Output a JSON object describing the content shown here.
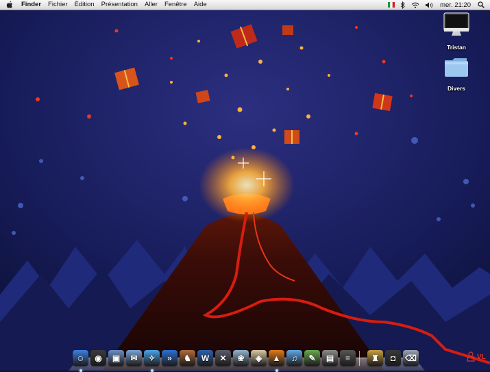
{
  "menubar": {
    "app_name": "Finder",
    "menus": [
      "Fichier",
      "Édition",
      "Présentation",
      "Aller",
      "Fenêtre",
      "Aide"
    ],
    "clock": "mer. 21:20"
  },
  "desktop": {
    "icons": [
      {
        "label": "Tristan",
        "icon": "imac-icon"
      },
      {
        "label": "Divers",
        "icon": "folder-icon"
      }
    ]
  },
  "dock": {
    "apps": [
      {
        "name": "finder",
        "color": "#3c7fe0",
        "glyph": "☺",
        "running": true
      },
      {
        "name": "dashboard",
        "color": "#3a3a3a",
        "glyph": "◉",
        "running": false
      },
      {
        "name": "preview",
        "color": "#6b8fc4",
        "glyph": "▣",
        "running": false
      },
      {
        "name": "mail-stamp",
        "color": "#7aa2d6",
        "glyph": "✉",
        "running": false
      },
      {
        "name": "safari",
        "color": "#4aa3e8",
        "glyph": "✧",
        "running": true
      },
      {
        "name": "quicksilver",
        "color": "#2d6fd2",
        "glyph": "»",
        "running": false
      },
      {
        "name": "automator",
        "color": "#b06a3a",
        "glyph": "♞",
        "running": false
      },
      {
        "name": "wireless",
        "color": "#2d5fb0",
        "glyph": "W",
        "running": false
      },
      {
        "name": "system-x",
        "color": "#5a5a6a",
        "glyph": "✕",
        "running": false
      },
      {
        "name": "iphoto",
        "color": "#8fb4d0",
        "glyph": "❀",
        "running": false
      },
      {
        "name": "photo-tool",
        "color": "#d8c8a0",
        "glyph": "◈",
        "running": false
      },
      {
        "name": "vlc",
        "color": "#e07a1a",
        "glyph": "▲",
        "running": true
      },
      {
        "name": "itunes",
        "color": "#5fa8e6",
        "glyph": "♫",
        "running": false
      },
      {
        "name": "tool",
        "color": "#6aa84f",
        "glyph": "✎",
        "running": false
      },
      {
        "name": "screen",
        "color": "#8a8a8a",
        "glyph": "▤",
        "running": false
      },
      {
        "name": "utility",
        "color": "#555",
        "glyph": "≡",
        "running": false
      }
    ],
    "right_items": [
      {
        "name": "game",
        "color": "#c8a040",
        "glyph": "♜"
      },
      {
        "name": "ipod",
        "color": "#3a3a3a",
        "glyph": "◘"
      },
      {
        "name": "trash",
        "color": "#9aa6b4",
        "glyph": "⌫"
      }
    ]
  },
  "watermark": {
    "text": "VL"
  }
}
